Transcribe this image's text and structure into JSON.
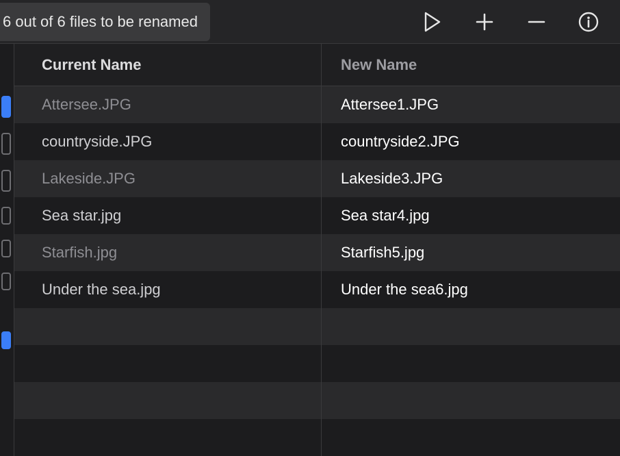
{
  "toolbar": {
    "status_text": "6 out of 6 files to be renamed"
  },
  "columns": {
    "current": "Current Name",
    "new": "New Name"
  },
  "rows": [
    {
      "current": "Attersee.JPG",
      "new": "Attersee1.JPG",
      "selected": true
    },
    {
      "current": "countryside.JPG",
      "new": "countryside2.JPG",
      "selected": false
    },
    {
      "current": "Lakeside.JPG",
      "new": "Lakeside3.JPG",
      "selected": false
    },
    {
      "current": "Sea star.jpg",
      "new": "Sea star4.jpg",
      "selected": false
    },
    {
      "current": "Starfish.jpg",
      "new": "Starfish5.jpg",
      "selected": false
    },
    {
      "current": "Under the sea.jpg",
      "new": "Under the sea6.jpg",
      "selected": false
    }
  ]
}
